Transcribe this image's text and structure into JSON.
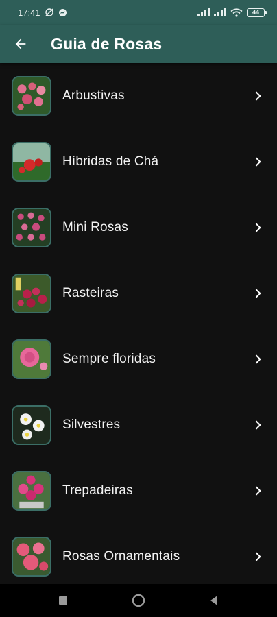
{
  "status_bar": {
    "time": "17:41",
    "battery": "44"
  },
  "app_bar": {
    "title": "Guia de Rosas"
  },
  "categories": [
    {
      "label": "Arbustivas",
      "thumb_color": "#d8607a"
    },
    {
      "label": "Híbridas de Chá",
      "thumb_color": "#d42a2a"
    },
    {
      "label": "Mini Rosas",
      "thumb_color": "#c94b7d"
    },
    {
      "label": "Rasteiras",
      "thumb_color": "#b8204a"
    },
    {
      "label": "Sempre floridas",
      "thumb_color": "#e7679a"
    },
    {
      "label": "Silvestres",
      "thumb_color": "#f2f2f2"
    },
    {
      "label": "Trepadeiras",
      "thumb_color": "#d6337a"
    },
    {
      "label": "Rosas Ornamentais",
      "thumb_color": "#e35a7a"
    }
  ],
  "colors": {
    "primary": "#2e5e58",
    "background": "#111111",
    "thumb_border": "#3b6e66"
  },
  "icons": {
    "back": "arrow-left-icon",
    "chevron": "chevron-right-icon"
  }
}
